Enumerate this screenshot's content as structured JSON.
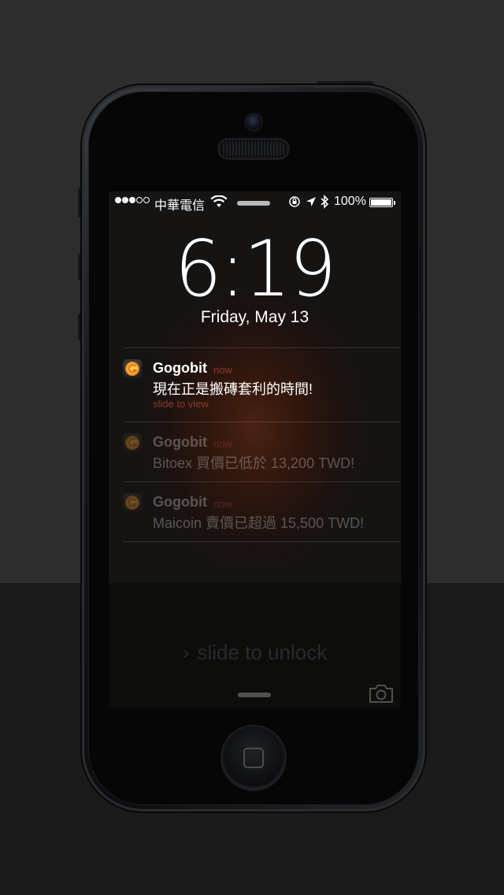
{
  "status_bar": {
    "signal_dots": [
      true,
      true,
      true,
      false,
      false
    ],
    "carrier": "中華電信",
    "battery_percent": "100%",
    "battery_level": 1.0
  },
  "lock": {
    "time": "6:19",
    "date": "Friday, May 13"
  },
  "notifications": [
    {
      "app": "Gogobit",
      "time": "now",
      "body": "現在正是搬磚套利的時間!",
      "hint": "slide to view"
    },
    {
      "app": "Gogobit",
      "time": "now",
      "body": "Bitoex 買價已低於 13,200 TWD!"
    },
    {
      "app": "Gogobit",
      "time": "now",
      "body": "Maicoin 賣價已超過 15,500 TWD!"
    }
  ],
  "unlock": {
    "label": "slide to unlock",
    "chevron": "›"
  },
  "icons": {
    "wifi": "wifi-icon",
    "rotation_lock": "rotation-lock-icon",
    "location": "location-arrow-icon",
    "bluetooth": "bluetooth-icon",
    "camera": "camera-icon",
    "app": "gogobit-logo-icon"
  },
  "colors": {
    "accent_notification_time": "#8a3f2e",
    "app_icon": "#f28b1d"
  }
}
